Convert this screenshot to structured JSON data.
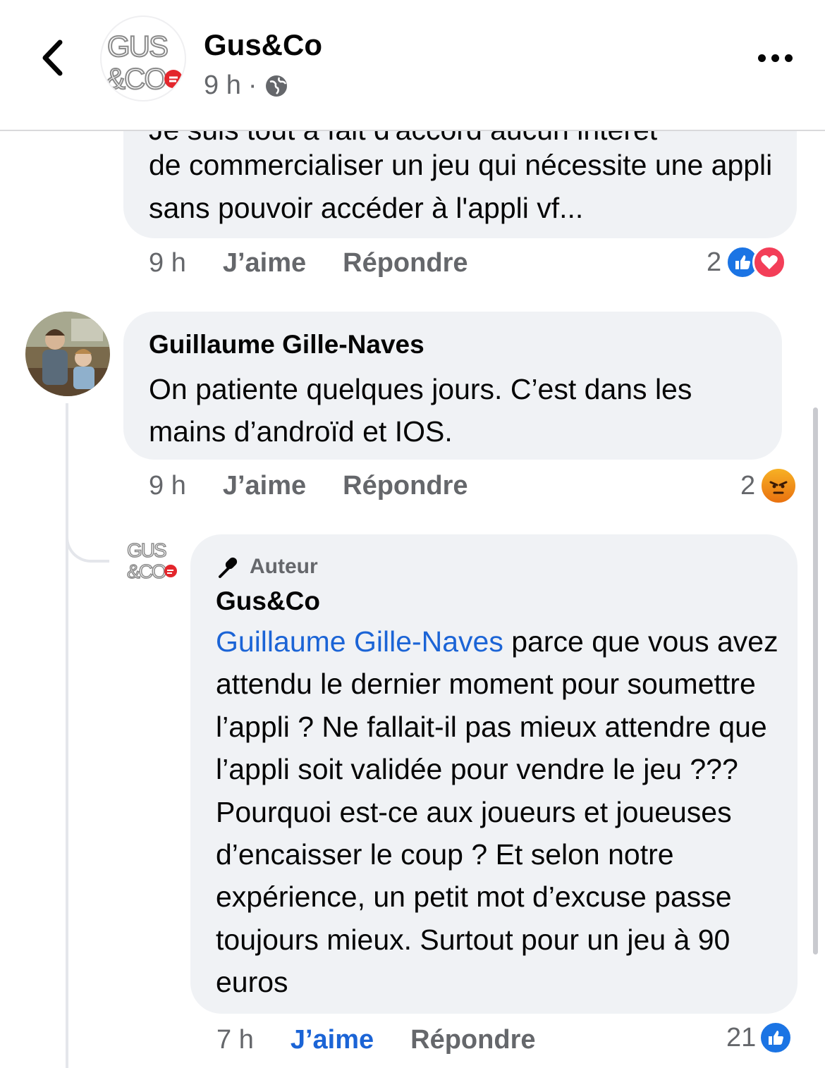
{
  "header": {
    "page_name": "Gus&Co",
    "time": "9 h",
    "separator": "·",
    "logo_text_top": "GUS",
    "logo_text_bottom": "&CO"
  },
  "comments": [
    {
      "partial_text": "Je suis tout à fait d'accord aucun intérêt",
      "text": "de commercialiser un jeu qui nécessite une appli sans pouvoir accéder à l'appli vf...",
      "time": "9 h",
      "like_label": "J’aime",
      "reply_label": "Répondre",
      "reaction_count": "2",
      "reactions": [
        "like-icon",
        "love-icon"
      ]
    },
    {
      "author": "Guillaume Gille-Naves",
      "text": "On patiente quelques jours. C’est dans les mains d’androïd et IOS.",
      "time": "9 h",
      "like_label": "J’aime",
      "reply_label": "Répondre",
      "reaction_count": "2",
      "reactions": [
        "angry-icon"
      ]
    },
    {
      "badge": "Auteur",
      "author": "Gus&Co",
      "mention": "Guillaume Gille-Naves",
      "text": " parce que vous avez attendu le dernier moment pour soumettre l’appli ? Ne fallait-il pas mieux attendre que l’appli soit validée pour vendre le jeu ??? Pourquoi est-ce aux joueurs et joueuses d’encaisser le coup ? Et selon notre expérience, un petit mot d’excuse passe toujours mieux. Surtout pour un jeu à 90 euros",
      "time": "7 h",
      "like_label": "J’aime",
      "reply_label": "Répondre",
      "reaction_count": "21",
      "reactions": [
        "like-icon"
      ],
      "liked": true
    }
  ],
  "colors": {
    "like_blue": "#1b64d6",
    "bubble_bg": "#f0f2f5",
    "secondary_text": "#65676b",
    "love_red": "#f33e58",
    "angry_orange": "#e9710f",
    "brand_red": "#e3262c"
  }
}
